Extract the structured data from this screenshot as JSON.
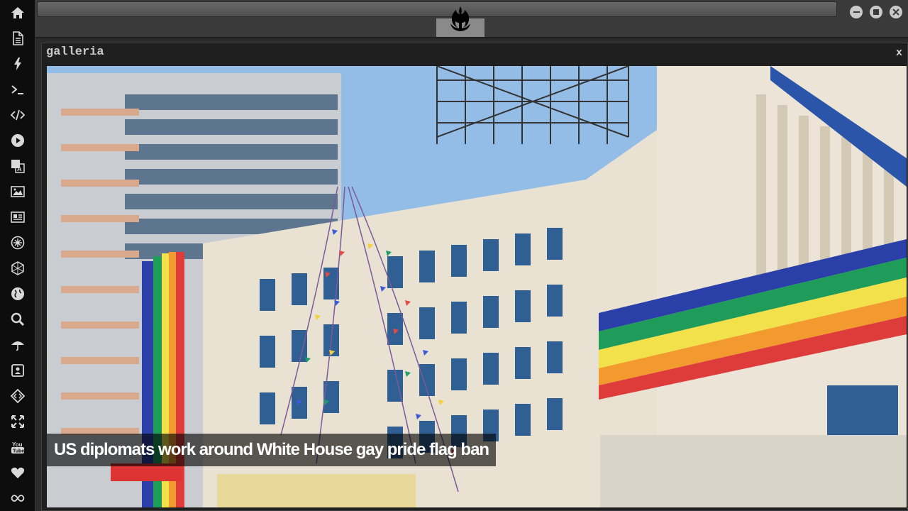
{
  "sidebar": {
    "icons": [
      "home-icon",
      "document-icon",
      "lightning-icon",
      "terminal-icon",
      "code-icon",
      "play-icon",
      "translate-icon",
      "image-icon",
      "newspaper-icon",
      "rebel-icon",
      "empire-icon",
      "globe-icon",
      "search-icon",
      "umbrella-icon",
      "id-card-icon",
      "embed-icon",
      "expand-icon",
      "youtube-icon",
      "heart-icon",
      "infinity-icon"
    ]
  },
  "topbar": {
    "emblem_icon": "rebel-alliance-icon"
  },
  "window_controls": [
    "minimize-icon",
    "maximize-icon",
    "close-icon"
  ],
  "window": {
    "title": "galleria",
    "close_label": "x",
    "caption": "US diplomats work around White House gay pride flag ban"
  },
  "colors": {
    "sidebar_bg": "#0d0d0d",
    "window_bg": "#1f1f1f",
    "caption_bg": "rgba(0,0,0,0.62)",
    "icon_color": "#d9d9d9"
  }
}
